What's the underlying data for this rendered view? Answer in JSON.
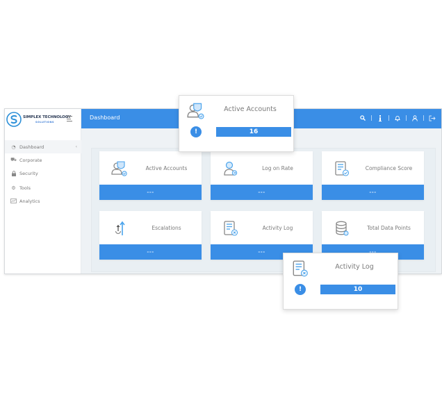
{
  "brand": {
    "name": "SIMPLEX TECHNOLOGY",
    "subtitle": "SOLUTIONS",
    "color": "#3a8ee6"
  },
  "sidebar": {
    "items": [
      {
        "label": "Dashboard",
        "icon": "dashboard-icon",
        "active": true,
        "chevron": "‹"
      },
      {
        "label": "Corporate",
        "icon": "car-icon"
      },
      {
        "label": "Security",
        "icon": "lock-icon"
      },
      {
        "label": "Tools",
        "icon": "gear-icon"
      },
      {
        "label": "Analytics",
        "icon": "chart-icon"
      }
    ]
  },
  "header": {
    "title": "Dashboard",
    "icons": [
      "search-icon",
      "info-icon",
      "bell-icon",
      "user-icon",
      "logout-icon"
    ]
  },
  "cards": [
    {
      "label": "Active Accounts",
      "value": "---",
      "icon": "users-shield-icon"
    },
    {
      "label": "Log on Rate",
      "value": "---",
      "icon": "user-login-icon"
    },
    {
      "label": "Compliance Score",
      "value": "---",
      "icon": "checklist-icon"
    },
    {
      "label": "Escalations",
      "value": "---",
      "icon": "escalation-arrow-icon"
    },
    {
      "label": "Activity Log",
      "value": "---",
      "icon": "activity-log-icon"
    },
    {
      "label": "Total Data Points",
      "value": "---",
      "icon": "database-icon"
    }
  ],
  "popups": [
    {
      "label": "Active Accounts",
      "value": "16",
      "alert": "!"
    },
    {
      "label": "Activity Log",
      "value": "10",
      "alert": "!"
    }
  ]
}
